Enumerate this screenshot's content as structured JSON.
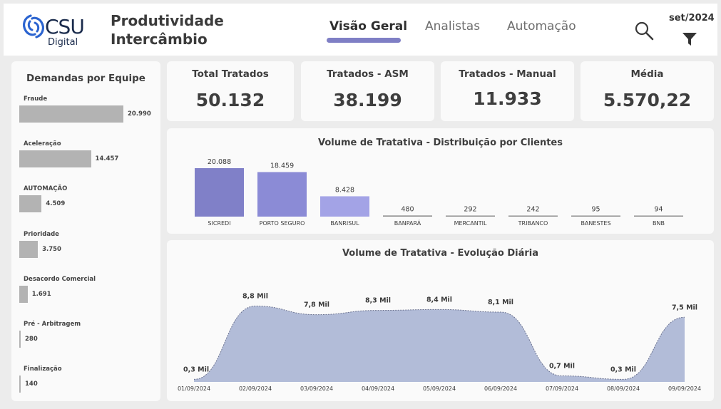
{
  "header": {
    "logo_word": "CSU",
    "logo_sub": "Digital",
    "title_line1": "Produtividade",
    "title_line2": "Intercâmbio",
    "tabs": [
      {
        "label": "Visão Geral",
        "active": true
      },
      {
        "label": "Analistas",
        "active": false
      },
      {
        "label": "Automação",
        "active": false
      }
    ],
    "period": "set/2024",
    "icons": {
      "search": "search-icon",
      "filter": "filter-icon"
    }
  },
  "colors": {
    "accent": "#7f7fc5",
    "bar_dark": "#8080c8",
    "bar_mid": "#8b8bd6",
    "bar_light": "#a3a3e6",
    "area": "#b2bcd8",
    "side_bar": "#b3b3b3",
    "logo_blue": "#2b64d0"
  },
  "team_demands": {
    "title": "Demandas por Equipe",
    "max": 20990,
    "items": [
      {
        "label": "Fraude",
        "value": 20990,
        "display": "20.990"
      },
      {
        "label": "Aceleração",
        "value": 14457,
        "display": "14.457"
      },
      {
        "label": "AUTOMAÇÃO",
        "value": 4509,
        "display": "4.509"
      },
      {
        "label": "Prioridade",
        "value": 3750,
        "display": "3.750"
      },
      {
        "label": "Desacordo Comercial",
        "value": 1691,
        "display": "1.691"
      },
      {
        "label": "Pré - Arbitragem",
        "value": 280,
        "display": "280"
      },
      {
        "label": "Finalização",
        "value": 140,
        "display": "140"
      }
    ]
  },
  "kpis": [
    {
      "title": "Total Tratados",
      "value": "50.132"
    },
    {
      "title": "Tratados - ASM",
      "value": "38.199"
    },
    {
      "title": "Tratados - Manual",
      "value": "11.933"
    },
    {
      "title": "Média",
      "value": "5.570,22"
    }
  ],
  "chart_data": [
    {
      "type": "bar",
      "title": "Volume de Tratativa - Distribuição por Clientes",
      "categories": [
        "SICREDI",
        "PORTO SEGURO",
        "BANRISUL",
        "BANPARÁ",
        "MERCANTIL",
        "TRIBANCO",
        "BANESTES",
        "BNB"
      ],
      "values": [
        20088,
        18459,
        8428,
        480,
        292,
        242,
        95,
        94
      ],
      "labels": [
        "20.088",
        "18.459",
        "8.428",
        "480",
        "292",
        "242",
        "95",
        "94"
      ],
      "ylim": [
        0,
        20088
      ]
    },
    {
      "type": "area",
      "title": "Volume de Tratativa - Evolução Diária",
      "x": [
        "01/09/2024",
        "02/09/2024",
        "03/09/2024",
        "04/09/2024",
        "05/09/2024",
        "06/09/2024",
        "07/09/2024",
        "08/09/2024",
        "09/09/2024"
      ],
      "values": [
        0.3,
        8.8,
        7.8,
        8.3,
        8.4,
        8.1,
        0.7,
        0.3,
        7.5
      ],
      "labels": [
        "0,3 Mil",
        "8,8 Mil",
        "7,8 Mil",
        "8,3 Mil",
        "8,4 Mil",
        "8,1 Mil",
        "0,7 Mil",
        "0,3 Mil",
        "7,5 Mil"
      ],
      "ylim": [
        0,
        10
      ]
    }
  ]
}
